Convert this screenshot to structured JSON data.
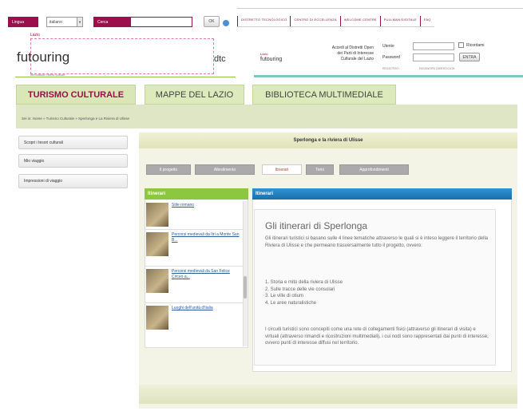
{
  "topbar": {
    "lingua_label": "Lingua",
    "language_value": "italiano",
    "cerca_label": "Cerca",
    "search_value": "",
    "ok_label": "OK",
    "nav": [
      "DISTRETTO TECNOLOGICO",
      "CENTRO DI ECCELLENZA",
      "WELCOME CENTRE",
      "PULLMAN DIGITALE",
      "FAQ"
    ]
  },
  "logo": {
    "small": "Lazio",
    "name": "futouring",
    "tagline": "innovation meets culture",
    "right": "dtc"
  },
  "promo": {
    "logo_small": "Lazio",
    "logo_name": "futouring",
    "line1": "Accedi al Distretti Open",
    "line2": "dei Parti di Interesse",
    "line3": "Culturale del Lazio"
  },
  "login": {
    "user_label": "Utente",
    "remember_label": "Ricordami",
    "password_label": "Password",
    "enter_label": "ENTRA",
    "register": "REGISTRATI",
    "forgot": "PASSWORD DIMENTICATA"
  },
  "main_tabs": [
    "TURISMO CULTURALE",
    "MAPPE DEL LAZIO",
    "BIBLIOTECA MULTIMEDIALE"
  ],
  "breadcrumb": "Sei in: Home » Turismo Culturale » Sperlonga e La Riviera di Ulisse",
  "sidebar": [
    "Scopri i tesori culturali",
    "Mio viaggio",
    "Impressioni di viaggio"
  ],
  "content": {
    "title": "Sperlonga e la riviera di Ulisse",
    "tabs": [
      "Il progetto",
      "Allestimento",
      "Itinerari",
      "Temi",
      "Approfondimenti"
    ],
    "active_tab": 2,
    "list_header": "Itinerari",
    "list": [
      "Stile romano",
      "Percorsi medievali da Itri a Monte San B...",
      "Percorsi medievali da San Felice Circeo a...",
      "Luoghi dell'unità d'Italia"
    ],
    "panel_header": "Itinerari",
    "panel_title": "Gli itinerari di Sperlonga",
    "para1": "Gli itinerari turistici si basano sulle 4 linee tematiche attraverso le quali si è inteso leggere il territorio della Riviera di Ulisse e che permeano trasversalmente tutto il progetto, ovvero:",
    "items": [
      "1. Storia e mito della riviera di Ulisse",
      "2. Sulle tracce delle vie consolari",
      "3. Le ville di otium",
      "4. Le aree naturalistiche"
    ],
    "para2": "I circuiti turistici sono concepiti come una rete di collegamenti fisici (attraverso gli itinerari di visita) e virtuali (attraverso rimandi e ricostruzioni multimediali), i cui nodi sono rappresentati dai punti di interesse, ovvero punti di interesse diffusi nel territorio."
  },
  "colors": {
    "magenta": "#9a0f4c",
    "green": "#8dc63f",
    "blue": "#1a7fc1",
    "tab_bg": "#ddeabc",
    "content_bg": "#f3f4e6"
  }
}
